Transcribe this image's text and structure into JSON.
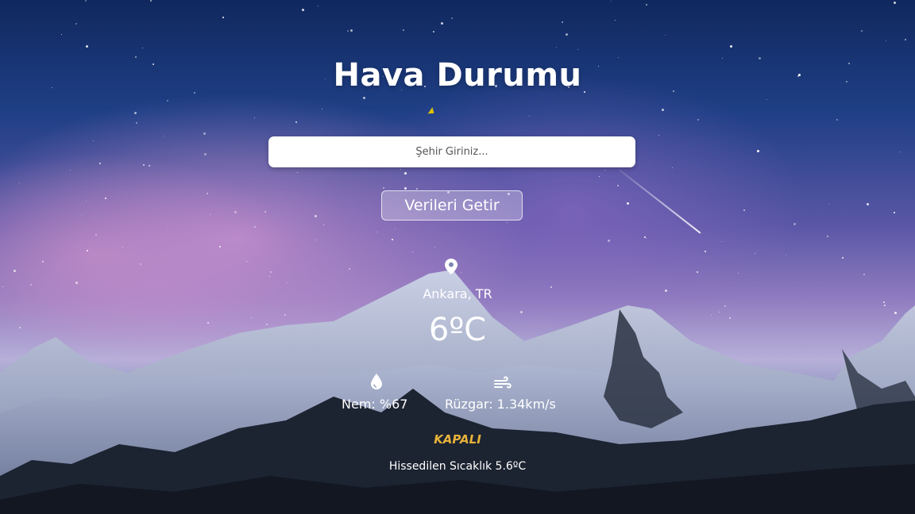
{
  "app": {
    "title": "Hava Durumu"
  },
  "search": {
    "placeholder": "Şehir Giriniz..."
  },
  "fetch_button": {
    "label": "Verileri Getir"
  },
  "weather": {
    "location": "Ankara, TR",
    "temperature": "6ºC",
    "humidity": "Nem: %67",
    "wind": "Rüzgar: 1.34km/s",
    "description": "KAPALI",
    "feels_like": "Hissedilen Sıcaklık 5.6ºC"
  },
  "icons": {
    "location": "map-pin-icon",
    "humidity": "water-drop-icon",
    "wind": "wind-icon"
  },
  "colors": {
    "description": "#e8b23a",
    "text": "#ffffff"
  }
}
